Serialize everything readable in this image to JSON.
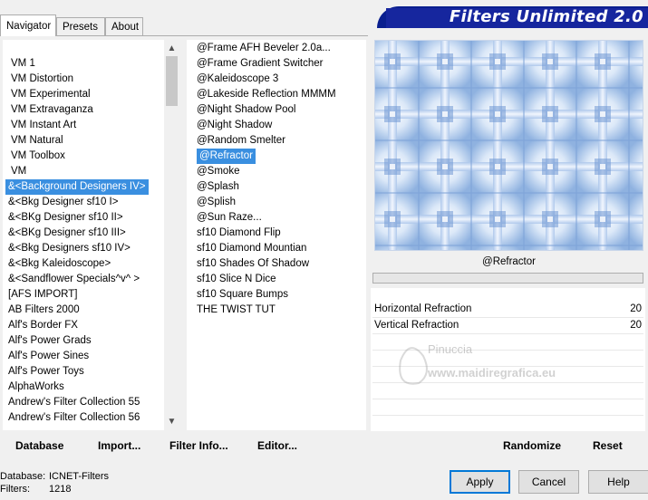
{
  "tabs": [
    {
      "label": "Navigator",
      "active": true
    },
    {
      "label": "Presets",
      "active": false
    },
    {
      "label": "About",
      "active": false
    }
  ],
  "banner_title": "Filters Unlimited 2.0",
  "categories": [
    "VM 1",
    "VM Distortion",
    "VM Experimental",
    "VM Extravaganza",
    "VM Instant Art",
    "VM Natural",
    "VM Toolbox",
    "VM",
    "&<Background Designers IV>",
    "&<Bkg Designer sf10 I>",
    "&<BKg Designer sf10 II>",
    "&<BKg Designer sf10 III>",
    "&<Bkg Designers sf10 IV>",
    "&<Bkg Kaleidoscope>",
    "&<Sandflower Specials^v^ >",
    "[AFS IMPORT]",
    "AB Filters 2000",
    "Alf's Border FX",
    "Alf's Power Grads",
    "Alf's Power Sines",
    "Alf's Power Toys",
    "AlphaWorks",
    "Andrew's Filter Collection 55",
    "Andrew's Filter Collection 56"
  ],
  "selected_category": "&<Background Designers IV>",
  "filters": [
    "@Frame AFH Beveler 2.0a...",
    "@Frame Gradient Switcher",
    "@Kaleidoscope 3",
    "@Lakeside Reflection MMMM",
    "@Night Shadow Pool",
    "@Night Shadow",
    "@Random Smelter",
    "@Refractor",
    "@Smoke",
    "@Splash",
    "@Splish",
    "@Sun Raze...",
    "sf10 Diamond Flip",
    "sf10 Diamond Mountian",
    "sf10 Shades Of Shadow",
    "sf10 Slice N Dice",
    "sf10 Square Bumps",
    "THE TWIST TUT"
  ],
  "selected_filter": "@Refractor",
  "filter_name": "@Refractor",
  "params": [
    {
      "label": "Horizontal Refraction",
      "value": "20"
    },
    {
      "label": "Vertical Refraction",
      "value": "20"
    }
  ],
  "left_buttons": {
    "database": "Database",
    "import": "Import...",
    "filter_info": "Filter Info...",
    "editor": "Editor..."
  },
  "right_buttons": {
    "randomize": "Randomize",
    "reset": "Reset"
  },
  "status": {
    "database_label": "Database:",
    "database_value": "ICNET-Filters",
    "filters_label": "Filters:",
    "filters_value": "1218"
  },
  "dialog_buttons": {
    "apply": "Apply",
    "cancel": "Cancel",
    "help": "Help"
  },
  "watermark": "Pinuccia www.maidiregrafica.eu",
  "colors": {
    "selection": "#3a8fe0",
    "banner": "#0a1f8f",
    "primary_button_border": "#0078d7"
  }
}
